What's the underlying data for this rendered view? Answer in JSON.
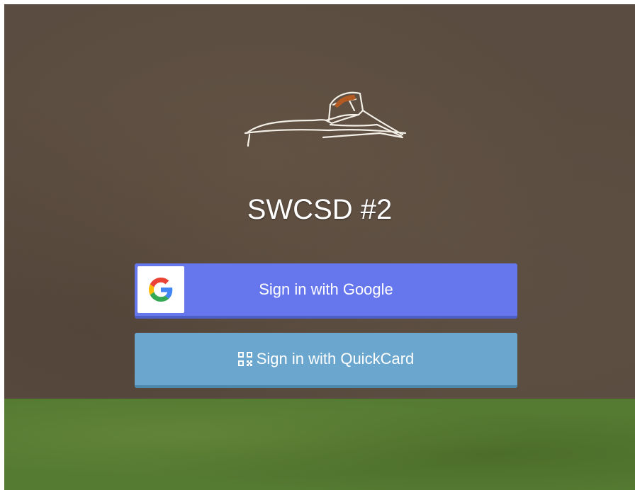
{
  "page": {
    "title": "SWCSD #2"
  },
  "auth": {
    "google_label": "Sign in with Google",
    "quickcard_label": "Sign in with QuickCard"
  },
  "icons": {
    "google": "google-g-icon",
    "quickcard": "qr-code-icon",
    "logo": "mesa-rock-logo"
  },
  "colors": {
    "background_brown": "#5a4c40",
    "background_green": "#557a32",
    "google_button": "#6677ee",
    "quickcard_button": "#6aa6cd",
    "text": "#ffffff"
  }
}
